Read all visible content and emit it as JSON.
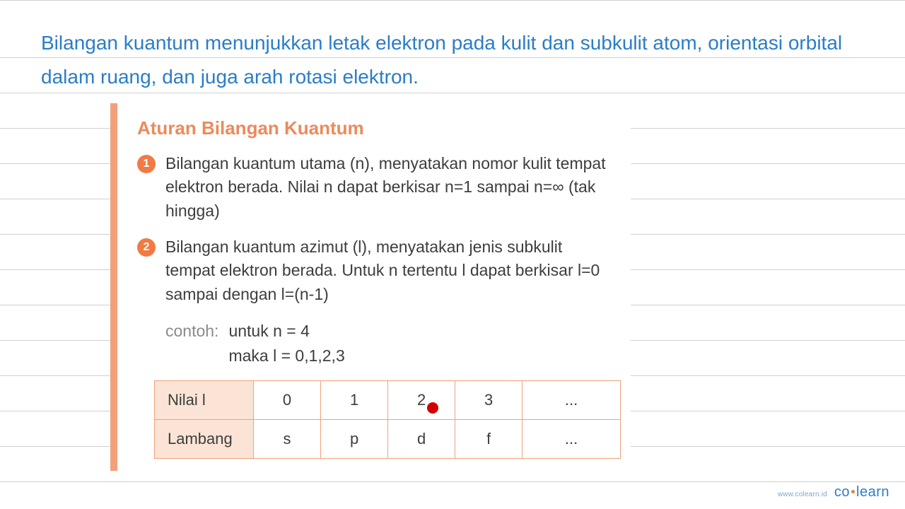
{
  "header": {
    "text": "Bilangan kuantum menunjukkan letak elektron pada kulit dan subkulit atom, orientasi orbital dalam ruang, dan juga arah rotasi elektron."
  },
  "notecard": {
    "title": "Aturan Bilangan Kuantum",
    "rules": [
      {
        "num": "1",
        "text": "Bilangan kuantum utama (n), menyatakan nomor kulit tempat elektron berada. Nilai n dapat berkisar n=1 sampai n=∞ (tak hingga)"
      },
      {
        "num": "2",
        "text": "Bilangan kuantum azimut (l), menyatakan jenis subkulit tempat elektron berada. Untuk n tertentu l dapat berkisar l=0 sampai dengan l=(n-1)"
      }
    ],
    "example": {
      "label": "contoh:",
      "line1": "untuk n = 4",
      "line2": "maka l = 0,1,2,3"
    },
    "table": {
      "row1_header": "Nilai l",
      "row1": [
        "0",
        "1",
        "2",
        "3",
        "..."
      ],
      "row2_header": "Lambang",
      "row2": [
        "s",
        "p",
        "d",
        "f",
        "..."
      ]
    }
  },
  "footer": {
    "url": "www.colearn.id",
    "brand_left": "co",
    "brand_right": "learn"
  },
  "ruled_line_positions": [
    80,
    130,
    180,
    230,
    280,
    330,
    380,
    430,
    480,
    530,
    580,
    630,
    680
  ]
}
